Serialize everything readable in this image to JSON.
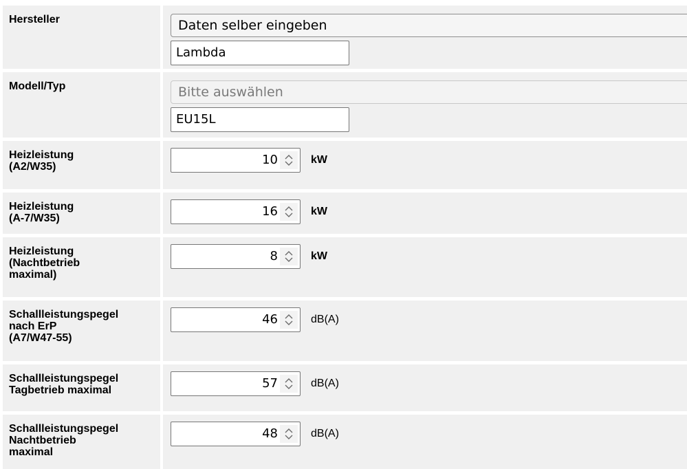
{
  "rows": {
    "hersteller": {
      "label": "Hersteller",
      "select_value": "Daten selber eingeben",
      "text_value": "Lambda"
    },
    "modell": {
      "label": "Modell/Typ",
      "select_placeholder": "Bitte auswählen",
      "text_value": "EU15L"
    },
    "heiz_a2": {
      "label": "Heizleistung\n(A2/W35)",
      "value": "10",
      "unit": "kW"
    },
    "heiz_a7": {
      "label": "Heizleistung\n(A-7/W35)",
      "value": "16",
      "unit": "kW"
    },
    "heiz_nacht": {
      "label": "Heizleistung\n(Nachtbetrieb\nmaximal)",
      "value": "8",
      "unit": "kW"
    },
    "schall_erp": {
      "label": "Schallleistungspegel\nnach ErP\n(A7/W47-55)",
      "value": "46",
      "unit": "dB(A)"
    },
    "schall_tag": {
      "label": "Schallleistungspegel\nTagbetrieb maximal",
      "value": "57",
      "unit": "dB(A)"
    },
    "schall_nacht": {
      "label": "Schallleistungspegel\nNachtbetrieb\nmaximal",
      "value": "48",
      "unit": "dB(A)"
    }
  },
  "icons": {
    "select_arrow": "chevron-down-icon",
    "spinner": "spinner-up-down-icon"
  }
}
